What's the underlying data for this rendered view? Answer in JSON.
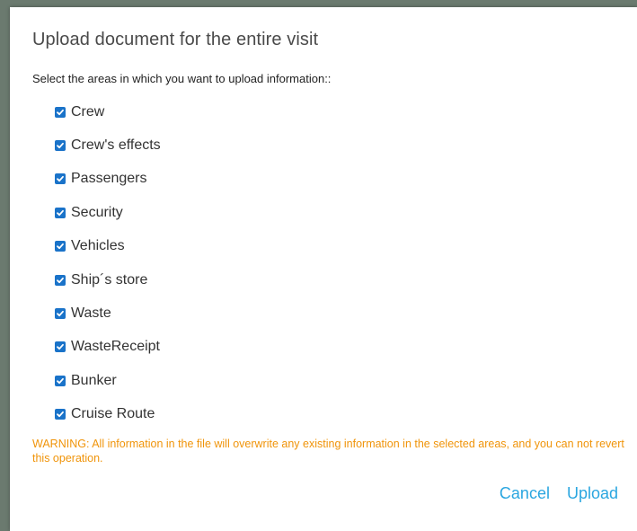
{
  "dialog": {
    "title": "Upload document for the entire visit",
    "instruction": "Select the areas in which you want to upload information::",
    "options": [
      {
        "label": "Crew",
        "checked": true
      },
      {
        "label": "Crew's effects",
        "checked": true
      },
      {
        "label": "Passengers",
        "checked": true
      },
      {
        "label": "Security",
        "checked": true
      },
      {
        "label": "Vehicles",
        "checked": true
      },
      {
        "label": "Ship´s store",
        "checked": true
      },
      {
        "label": "Waste",
        "checked": true
      },
      {
        "label": "WasteReceipt",
        "checked": true
      },
      {
        "label": "Bunker",
        "checked": true
      },
      {
        "label": "Cruise Route",
        "checked": true
      }
    ],
    "warning": "WARNING: All information in the file will overwrite any existing information in the selected areas, and you can not revert this operation.",
    "cancel_label": "Cancel",
    "upload_label": "Upload"
  },
  "colors": {
    "checkbox": "#1a73c9",
    "warning": "#f0940a",
    "action": "#2aa6e0",
    "title": "#4a4a4a"
  },
  "icons": {
    "checkbox_checked": "check-icon"
  }
}
